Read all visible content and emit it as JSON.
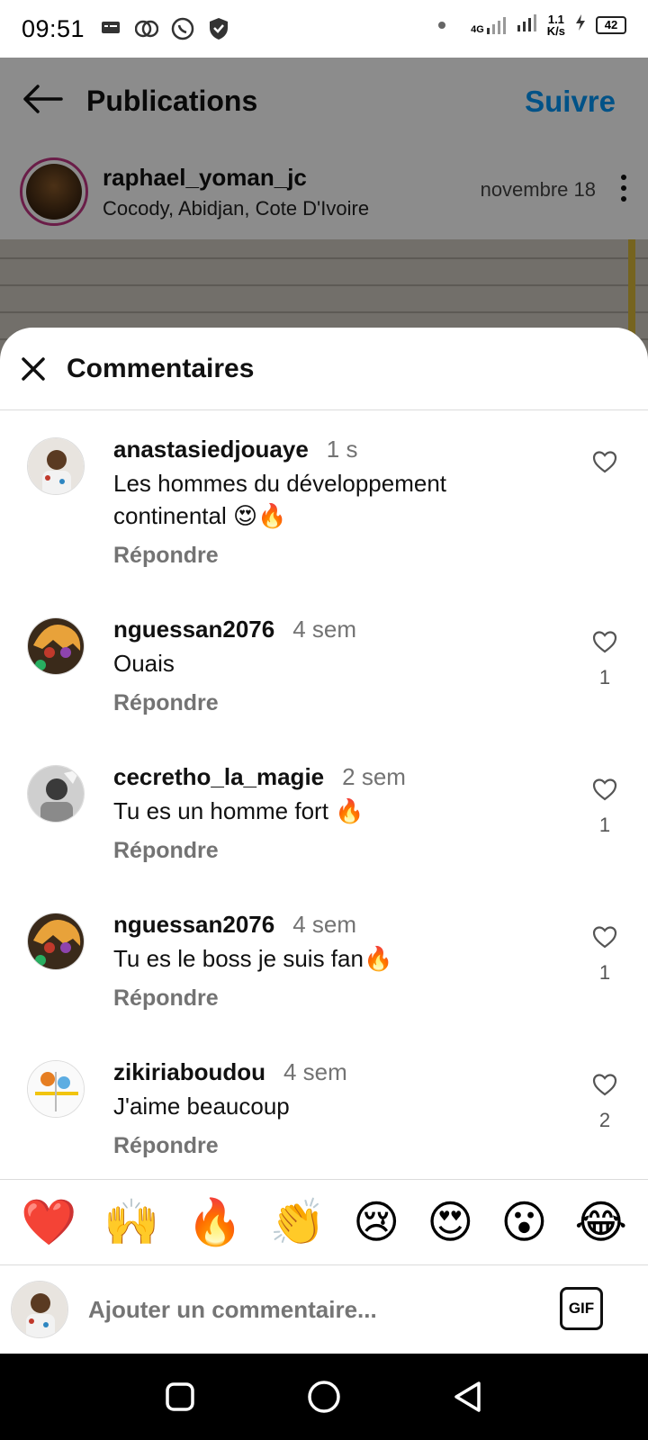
{
  "status_bar": {
    "time": "09:51",
    "network": "4G",
    "speed_value": "1.1",
    "speed_unit": "K/s",
    "battery": "42"
  },
  "post_screen": {
    "title": "Publications",
    "follow_label": "Suivre",
    "author": {
      "username": "raphael_yoman_jc",
      "location": "Cocody, Abidjan, Cote D'Ivoire",
      "date": "novembre 18"
    }
  },
  "sheet": {
    "title": "Commentaires",
    "comments": [
      {
        "username": "anastasiedjouaye",
        "time": "1 s",
        "text_line1": "Les hommes du développement",
        "text_line2": "continental 😍🔥",
        "reply_label": "Répondre",
        "likes": ""
      },
      {
        "username": "nguessan2076",
        "time": "4 sem",
        "text_line1": "Ouais",
        "text_line2": "",
        "reply_label": "Répondre",
        "likes": "1"
      },
      {
        "username": "cecretho_la_magie",
        "time": "2 sem",
        "text_line1": "Tu es un homme fort 🔥",
        "text_line2": "",
        "reply_label": "Répondre",
        "likes": "1"
      },
      {
        "username": "nguessan2076",
        "time": "4 sem",
        "text_line1": "Tu es le boss je suis fan🔥",
        "text_line2": "",
        "reply_label": "Répondre",
        "likes": "1"
      },
      {
        "username": "zikiriaboudou",
        "time": "4 sem",
        "text_line1": "J'aime beaucoup",
        "text_line2": "",
        "reply_label": "Répondre",
        "likes": "2"
      }
    ]
  },
  "emoji_bar": [
    "❤️",
    "🙌",
    "🔥",
    "👏",
    "😢",
    "😍",
    "😮",
    "😂"
  ],
  "composer": {
    "placeholder": "Ajouter un commentaire...",
    "gif_label": "GIF"
  },
  "colors": {
    "accent": "#0095f6",
    "muted": "#737373",
    "divider": "#dbdbdb"
  }
}
